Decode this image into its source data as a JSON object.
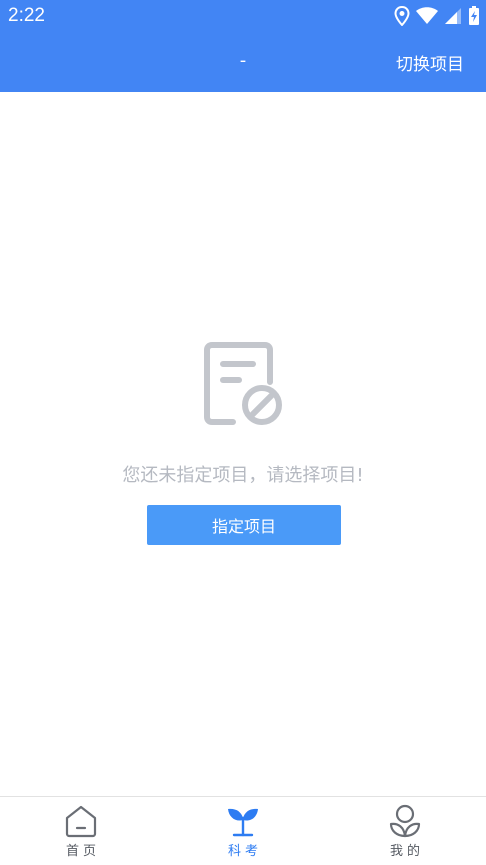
{
  "status_bar": {
    "time": "2:22",
    "icons": [
      "location-icon",
      "wifi-icon",
      "signal-icon",
      "battery-charging-icon"
    ]
  },
  "app_bar": {
    "title": "-",
    "action_label": "切换项目"
  },
  "empty_state": {
    "icon": "document-blocked-icon",
    "message": "您还未指定项目，请选择项目!",
    "button_label": "指定项目"
  },
  "bottom_nav": {
    "items": [
      {
        "label": "首页",
        "icon": "home-icon",
        "active": false
      },
      {
        "label": "科考",
        "icon": "sprout-icon",
        "active": true
      },
      {
        "label": "我的",
        "icon": "profile-leaf-icon",
        "active": false
      }
    ]
  },
  "colors": {
    "primary": "#4285f4",
    "button": "#4a9af8",
    "active_nav": "#2d7cf2",
    "muted_text": "#b5b9c1",
    "icon_gray": "#c3c6cc"
  }
}
